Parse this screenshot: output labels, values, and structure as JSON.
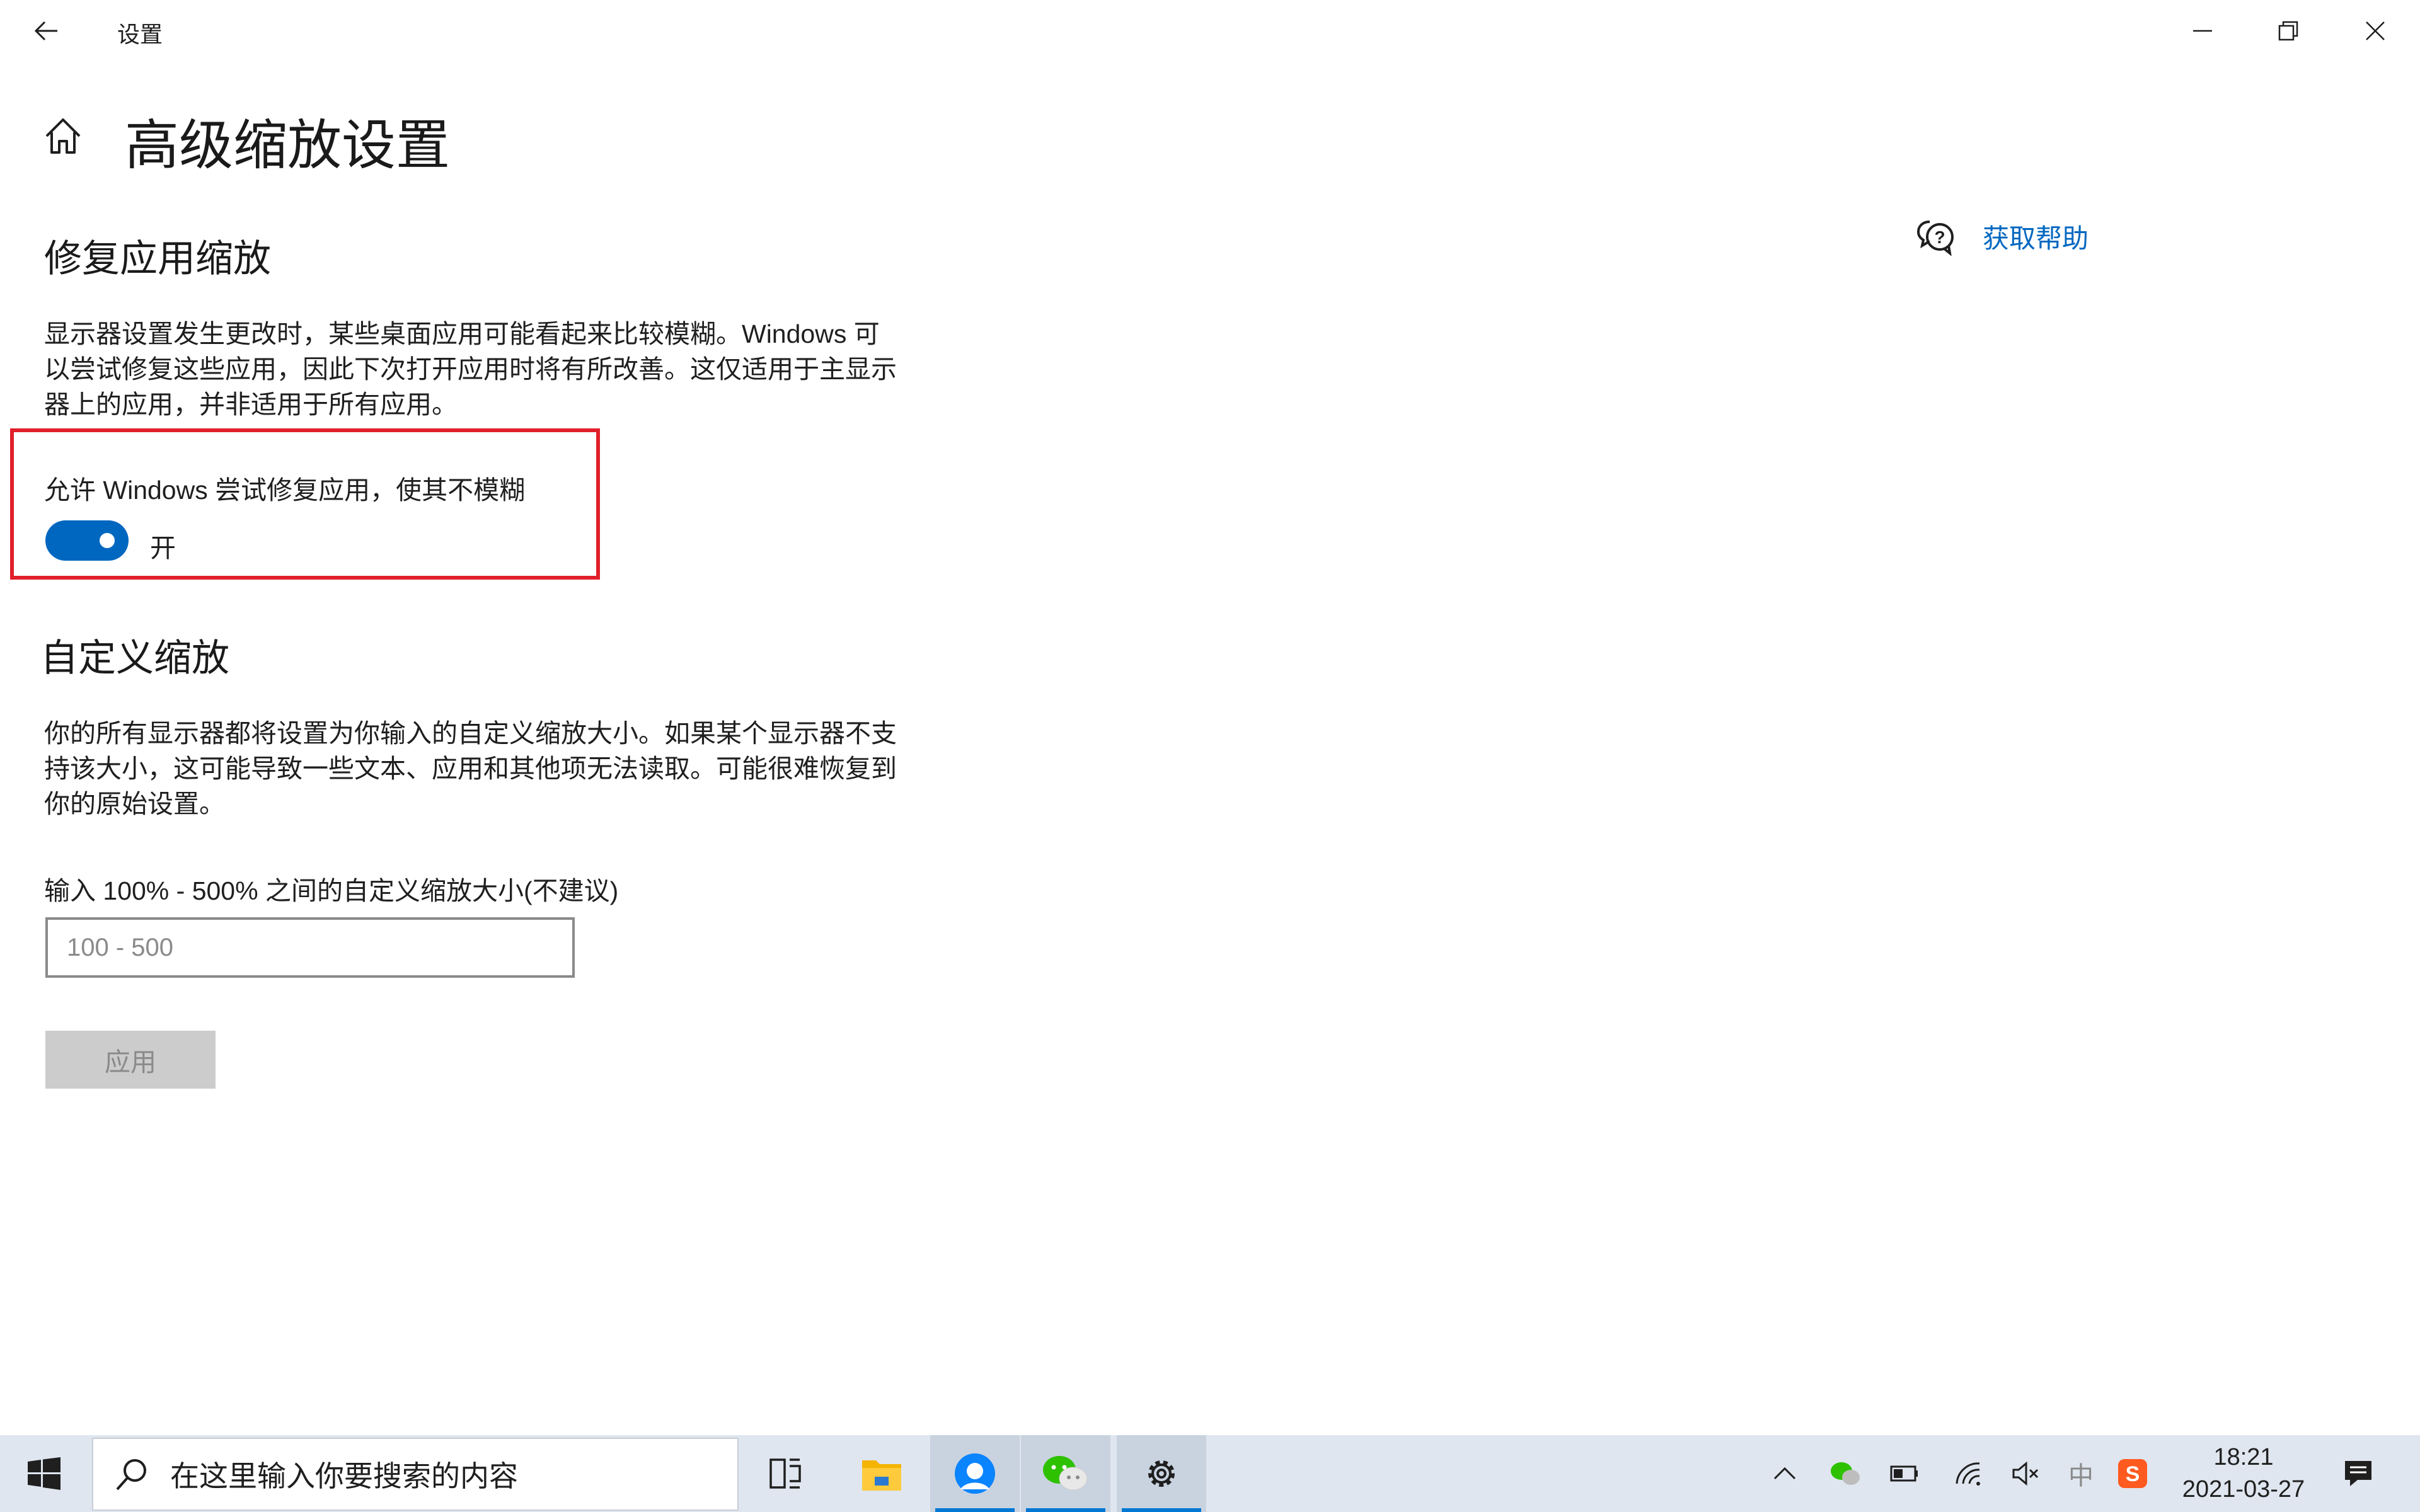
{
  "window": {
    "title": "设置"
  },
  "page": {
    "title": "高级缩放设置"
  },
  "help": {
    "label": "获取帮助"
  },
  "fix_section": {
    "title": "修复应用缩放",
    "description": "显示器设置发生更改时，某些桌面应用可能看起来比较模糊。Windows 可以尝试修复这些应用，因此下次打开应用时将有所改善。这仅适用于主显示器上的应用，并非适用于所有应用。",
    "toggle_label": "允许 Windows 尝试修复应用，使其不模糊",
    "toggle_state": "开",
    "toggle_on": true,
    "toggle_color": "#0067c0",
    "highlight_color": "#e0202a"
  },
  "custom_section": {
    "title": "自定义缩放",
    "description": "你的所有显示器都将设置为你输入的自定义缩放大小。如果某个显示器不支持该大小，这可能导致一些文本、应用和其他项无法读取。可能很难恢复到你的原始设置。",
    "input_label": "输入 100% - 500% 之间的自定义缩放大小(不建议)",
    "input_placeholder": "100 - 500",
    "input_value": "",
    "apply_label": "应用"
  },
  "taskbar": {
    "search_placeholder": "在这里输入你要搜索的内容",
    "apps": [
      {
        "name": "task-view-icon"
      },
      {
        "name": "file-explorer-icon"
      },
      {
        "name": "browser-icon"
      },
      {
        "name": "wechat-icon"
      },
      {
        "name": "settings-gear-icon"
      }
    ],
    "tray": {
      "ime": "中",
      "time": "18:21",
      "date": "2021-03-27"
    }
  }
}
